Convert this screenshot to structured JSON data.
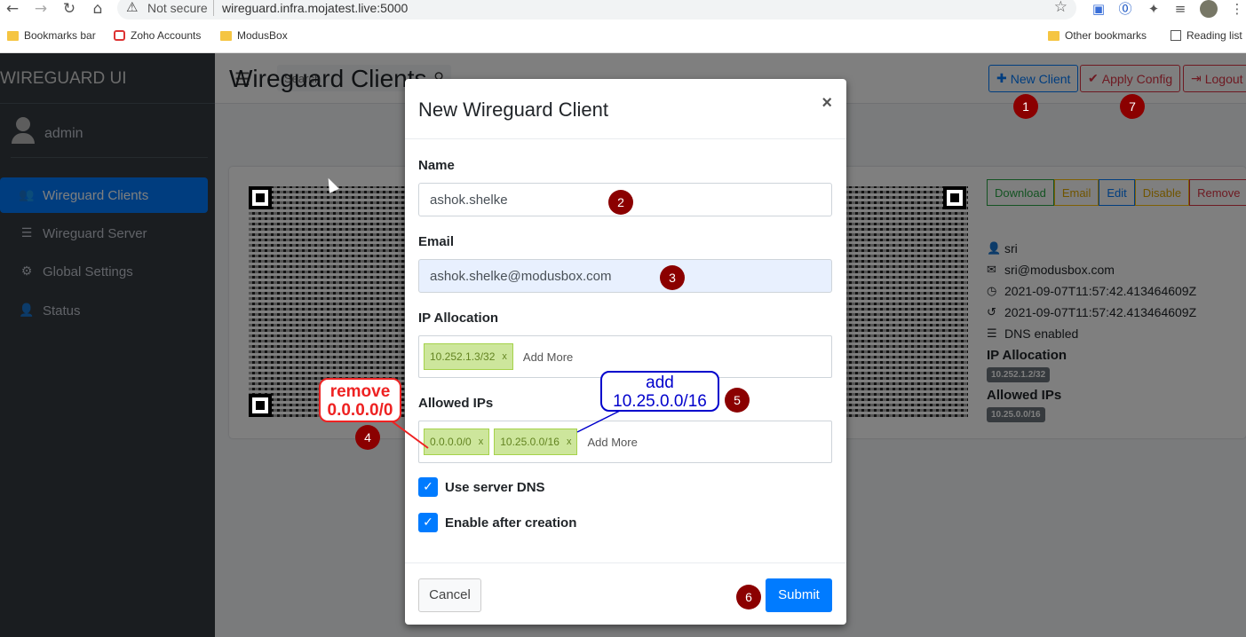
{
  "browser": {
    "security": "Not secure",
    "url": "wireguard.infra.mojatest.live:5000",
    "bookmarks": [
      "Bookmarks bar",
      "Zoho Accounts",
      "ModusBox"
    ],
    "other_bookmarks": "Other bookmarks",
    "reading_list": "Reading list"
  },
  "sidebar": {
    "brand": "WIREGUARD UI",
    "user": "admin",
    "items": [
      {
        "label": "Wireguard Clients",
        "icon": "users-icon",
        "active": true
      },
      {
        "label": "Wireguard Server",
        "icon": "server-icon"
      },
      {
        "label": "Global Settings",
        "icon": "gear-icon"
      },
      {
        "label": "Status",
        "icon": "user-icon"
      }
    ]
  },
  "header": {
    "search_placeholder": "Search",
    "new_client": "New Client",
    "apply_config": "Apply Config",
    "logout": "Logout"
  },
  "page_title": "Wireguard Clients",
  "client_card": {
    "actions": [
      "Download",
      "Email",
      "Edit",
      "Disable",
      "Remove"
    ],
    "name": "sri",
    "email": "sri@modusbox.com",
    "created": "2021-09-07T11:57:42.413464609Z",
    "updated": "2021-09-07T11:57:42.413464609Z",
    "dns": "DNS enabled",
    "ip_allocation_label": "IP Allocation",
    "ip_allocation": "10.252.1.2/32",
    "allowed_ips_label": "Allowed IPs",
    "allowed_ips": "10.25.0.0/16"
  },
  "modal": {
    "title": "New Wireguard Client",
    "close": "×",
    "name_label": "Name",
    "name_value": "ashok.shelke",
    "email_label": "Email",
    "email_value": "ashok.shelke@modusbox.com",
    "ip_label": "IP Allocation",
    "ip_tags": [
      "10.252.1.3/32"
    ],
    "allowed_label": "Allowed IPs",
    "allowed_tags": [
      "0.0.0.0/0",
      "10.25.0.0/16"
    ],
    "add_more": "Add More",
    "tag_remove": "x",
    "use_dns": "Use server DNS",
    "enable_after": "Enable after creation",
    "cancel": "Cancel",
    "submit": "Submit"
  },
  "annotations": {
    "steps": [
      "1",
      "2",
      "3",
      "4",
      "5",
      "6",
      "7"
    ],
    "remove_callout": [
      "remove",
      "0.0.0.0/0"
    ],
    "add_callout": [
      "add",
      "10.25.0.0/16"
    ]
  }
}
